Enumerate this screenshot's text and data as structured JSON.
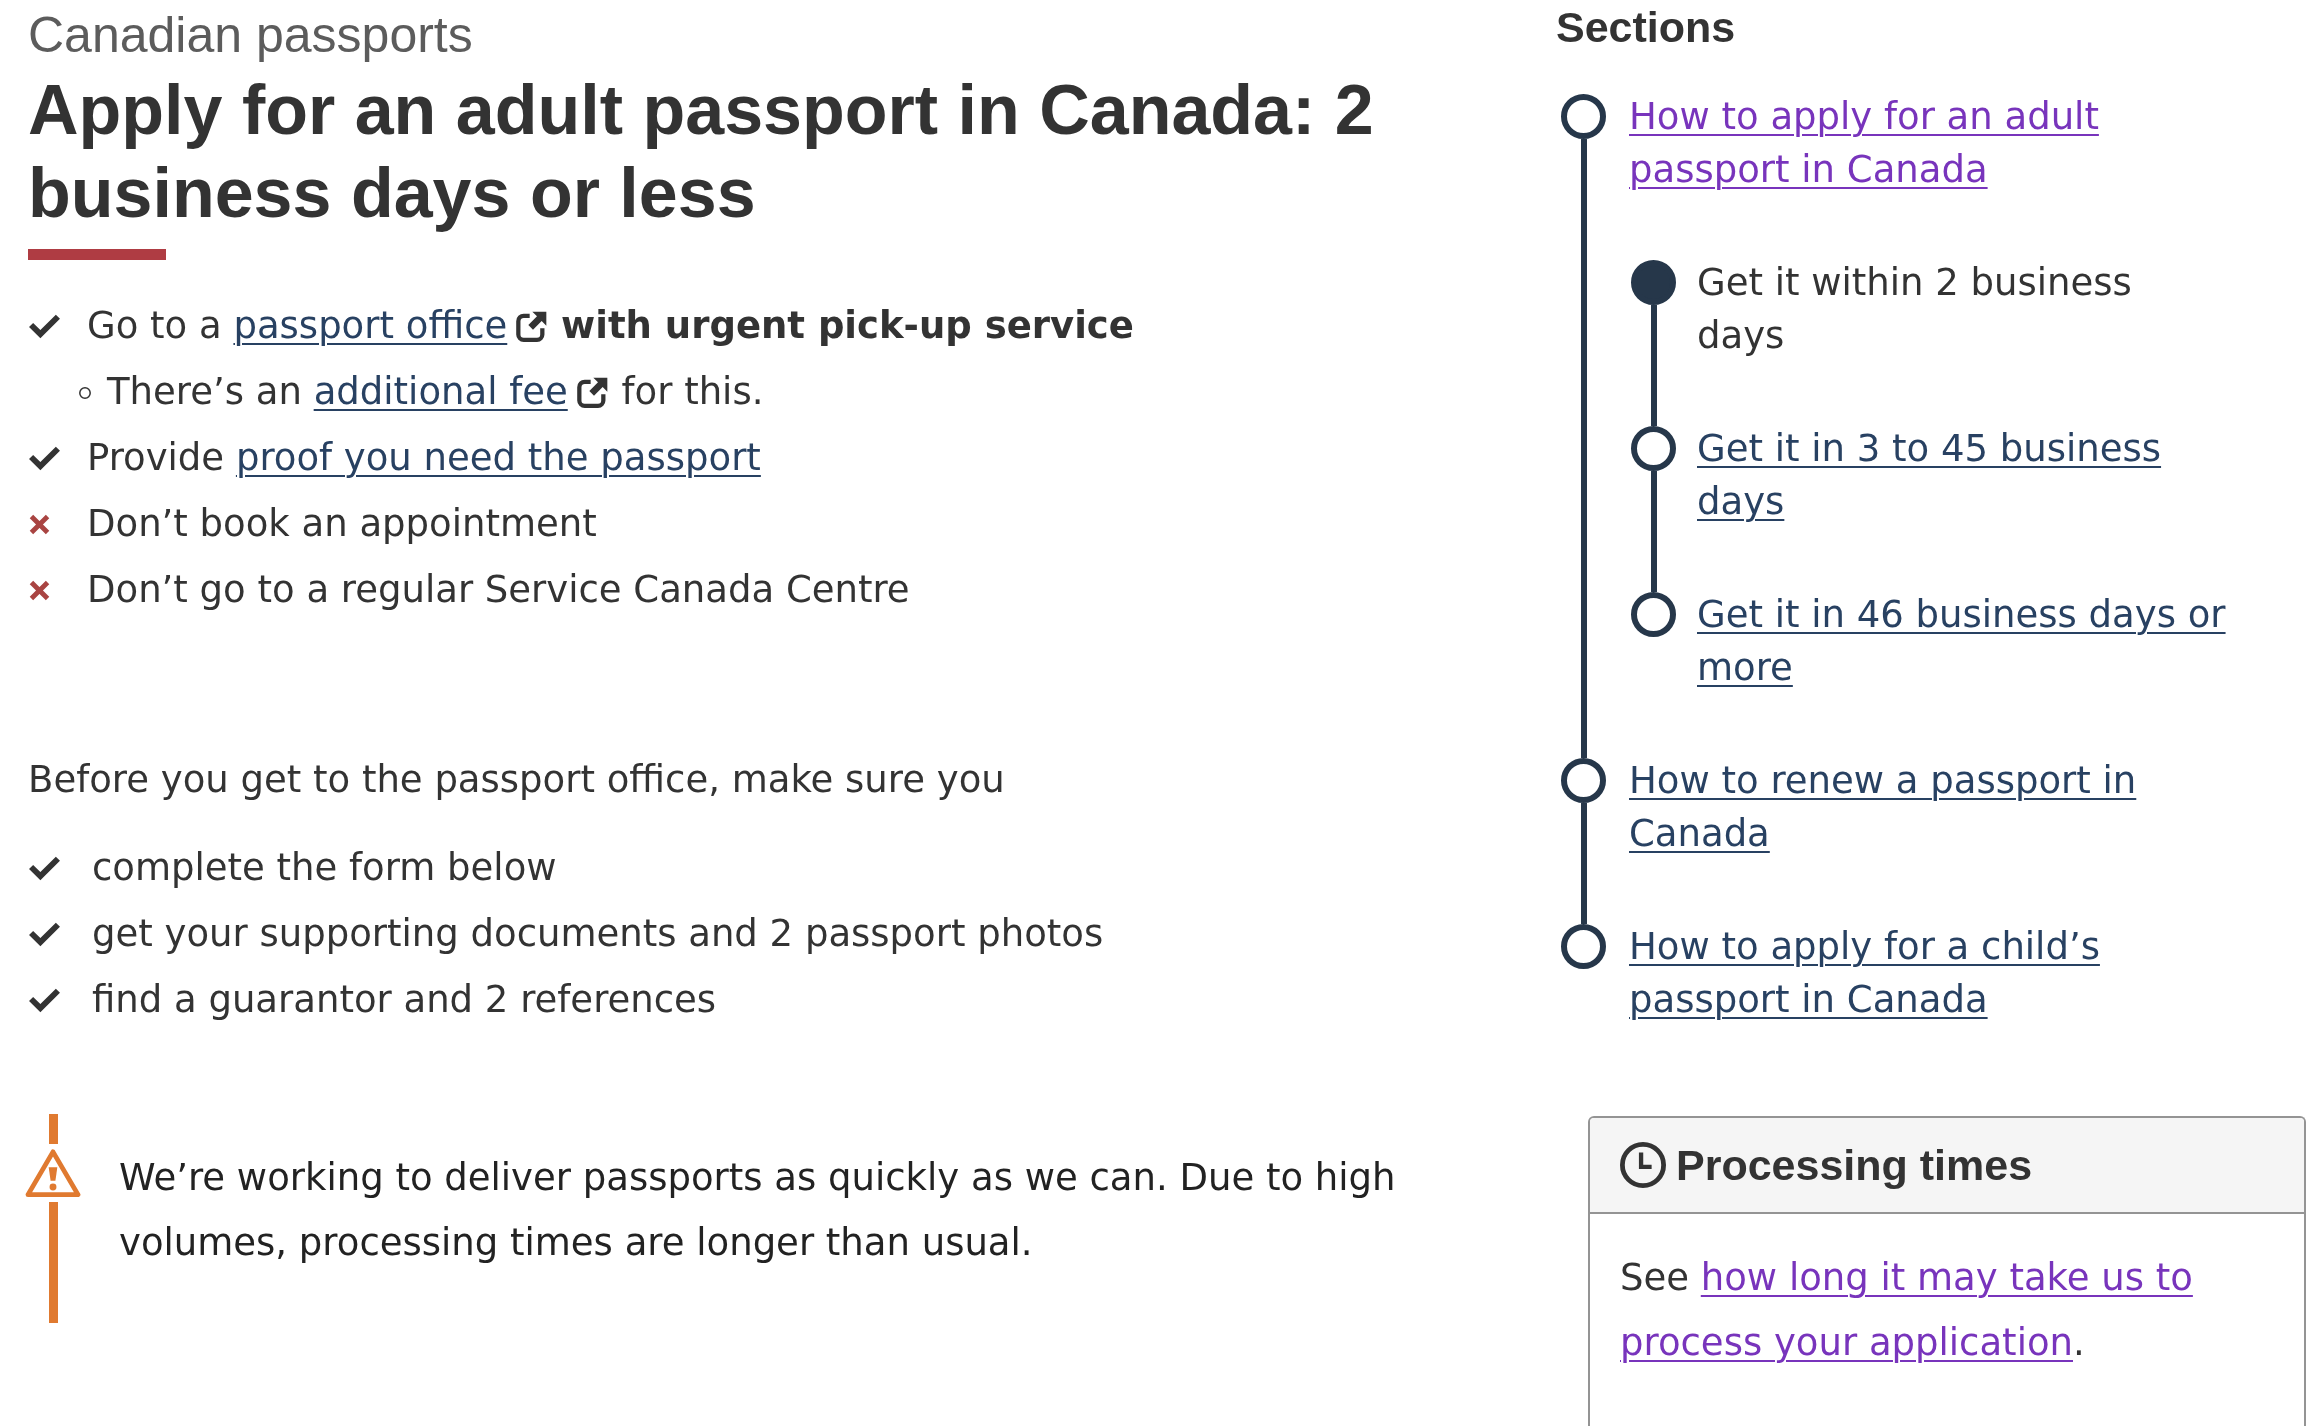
{
  "breadcrumb": "Canadian passports",
  "title": "Apply for an adult passport in Canada: 2 business days or less",
  "checklist": [
    {
      "kind": "check",
      "segments": [
        {
          "kind": "text",
          "text": "Go to a "
        },
        {
          "kind": "link",
          "text": "passport office",
          "external": true,
          "visited": false
        },
        {
          "kind": "text",
          "text": " **with urgent pick-up service**"
        }
      ],
      "children": [
        {
          "kind": "bullet",
          "segments": [
            {
              "kind": "text",
              "text": "There’s an "
            },
            {
              "kind": "link",
              "text": "additional fee",
              "external": true,
              "visited": false
            },
            {
              "kind": "text",
              "text": " for this."
            }
          ]
        }
      ]
    },
    {
      "kind": "check",
      "segments": [
        {
          "kind": "text",
          "text": "Provide "
        },
        {
          "kind": "link",
          "text": "proof you need the passport",
          "external": false,
          "visited": false
        }
      ]
    },
    {
      "kind": "cross",
      "segments": [
        {
          "kind": "text",
          "text": "Don’t book an appointment"
        }
      ]
    },
    {
      "kind": "cross",
      "segments": [
        {
          "kind": "text",
          "text": "Don’t go to a regular Service Canada Centre"
        }
      ]
    }
  ],
  "intro": "Before you get to the passport office, make sure you",
  "todo": [
    {
      "kind": "check",
      "text": "complete the form below"
    },
    {
      "kind": "check",
      "text": "get your supporting documents and 2 passport photos"
    },
    {
      "kind": "check",
      "text": "find a guarantor and 2 references"
    }
  ],
  "notice": {
    "kind": "warning",
    "text": "We’re working to deliver passports as quickly as we can. Due to high volumes, processing times are longer than usual."
  },
  "sections": {
    "title": "Sections",
    "items": [
      {
        "label": "How to apply for an adult passport in Canada",
        "visited": true,
        "selected": false,
        "children": [
          {
            "label": "Get it within 2 business days",
            "visited": false,
            "selected": true
          },
          {
            "label": "Get it in 3 to 45 business days",
            "visited": false,
            "selected": false
          },
          {
            "label": "Get it in 46 business days or more",
            "visited": false,
            "selected": false
          }
        ]
      },
      {
        "label": "How to renew a passport in Canada",
        "visited": false,
        "selected": false
      },
      {
        "label": "How to apply for a child’s passport in Canada",
        "visited": false,
        "selected": false
      }
    ]
  },
  "processing": {
    "title": "Processing times",
    "segments": [
      {
        "kind": "text",
        "text": "See "
      },
      {
        "kind": "link",
        "text": "how long it may take us to",
        "external": false,
        "visited": true
      },
      {
        "kind": "link",
        "text": "process your application",
        "external": false,
        "visited": true
      },
      {
        "kind": "text",
        "text": "."
      }
    ]
  }
}
